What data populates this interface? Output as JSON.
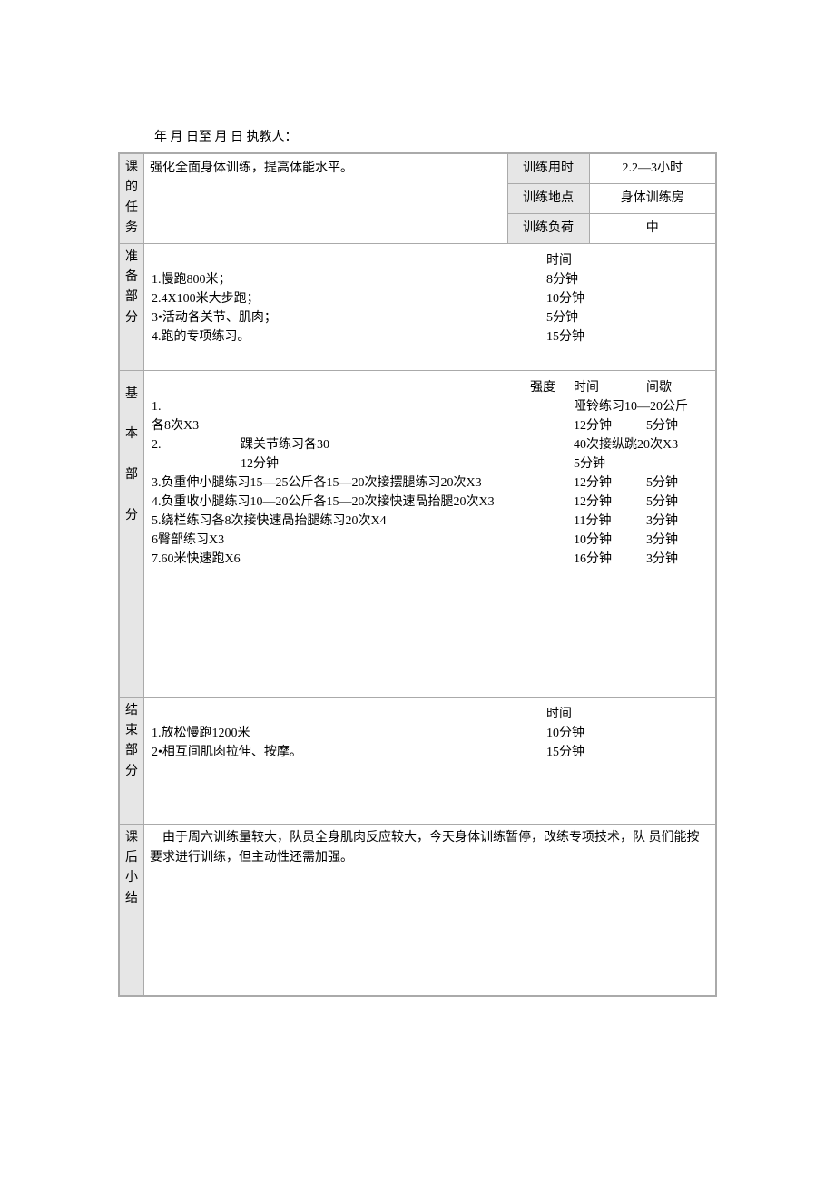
{
  "header": {
    "date_line": "年  月  日至  月  日  执教人："
  },
  "task": {
    "side_label": "课的任务",
    "content": "强化全面身体训练，提高体能水平。",
    "info": [
      {
        "label": "训练用时",
        "value": "2.2—3小时"
      },
      {
        "label": "训练地点",
        "value": "身体训练房"
      },
      {
        "label": "训练负荷",
        "value": "中"
      }
    ]
  },
  "prep": {
    "side_label": "准备部分",
    "time_header": "时间",
    "items": [
      {
        "text": "1.慢跑800米；",
        "time": "8分钟"
      },
      {
        "text": "2.4X100米大步跑；",
        "time": "10分钟"
      },
      {
        "text": "3•活动各关节、肌肉；",
        "time": "5分钟"
      },
      {
        "text": "4.跑的专项练习。",
        "time": "15分钟"
      }
    ]
  },
  "main": {
    "side_label": "基本部分",
    "headers": {
      "intensity": "强度",
      "time": "时间",
      "rest": "间歇"
    },
    "rows": [
      {
        "text": "1.",
        "time": "",
        "rest": "哑铃练习10—20公斤"
      },
      {
        "text": "各8次X3",
        "time": "12分钟",
        "rest": "5分钟"
      },
      {
        "text": "2.　　　　　　  踝关节练习各30",
        "time": "",
        "rest": "40次接纵跳20次X3"
      },
      {
        "text": "　　　　　　　12分钟",
        "time": "5分钟",
        "rest": ""
      },
      {
        "text": "3.负重伸小腿练习15—25公斤各15—20次接摆腿练习20次X3",
        "time": "12分钟",
        "rest": "5分钟"
      },
      {
        "text": "4.负重收小腿练习10—20公斤各15—20次接快速咼抬腿20次X3",
        "time": "12分钟",
        "rest": "5分钟"
      },
      {
        "text": "5.绕栏练习各8次接快速咼抬腿练习20次X4",
        "time": "11分钟",
        "rest": "3分钟"
      },
      {
        "text": "6臀部练习X3",
        "time": "10分钟",
        "rest": "3分钟"
      },
      {
        "text": "7.60米快速跑X6",
        "time": "16分钟",
        "rest": "3分钟"
      }
    ]
  },
  "end": {
    "side_label": "结束部分",
    "time_header": "时间",
    "items": [
      {
        "text": "1.放松慢跑1200米",
        "time": "10分钟"
      },
      {
        "text": "2•相互间肌肉拉伸、按摩。",
        "time": "15分钟"
      }
    ]
  },
  "summary": {
    "side_label": "课后小结",
    "text": "由于周六训练量较大，队员全身肌肉反应较大，今天身体训练暂停，改练专项技术，队  员们能按要求进行训练，但主动性还需加强。"
  }
}
